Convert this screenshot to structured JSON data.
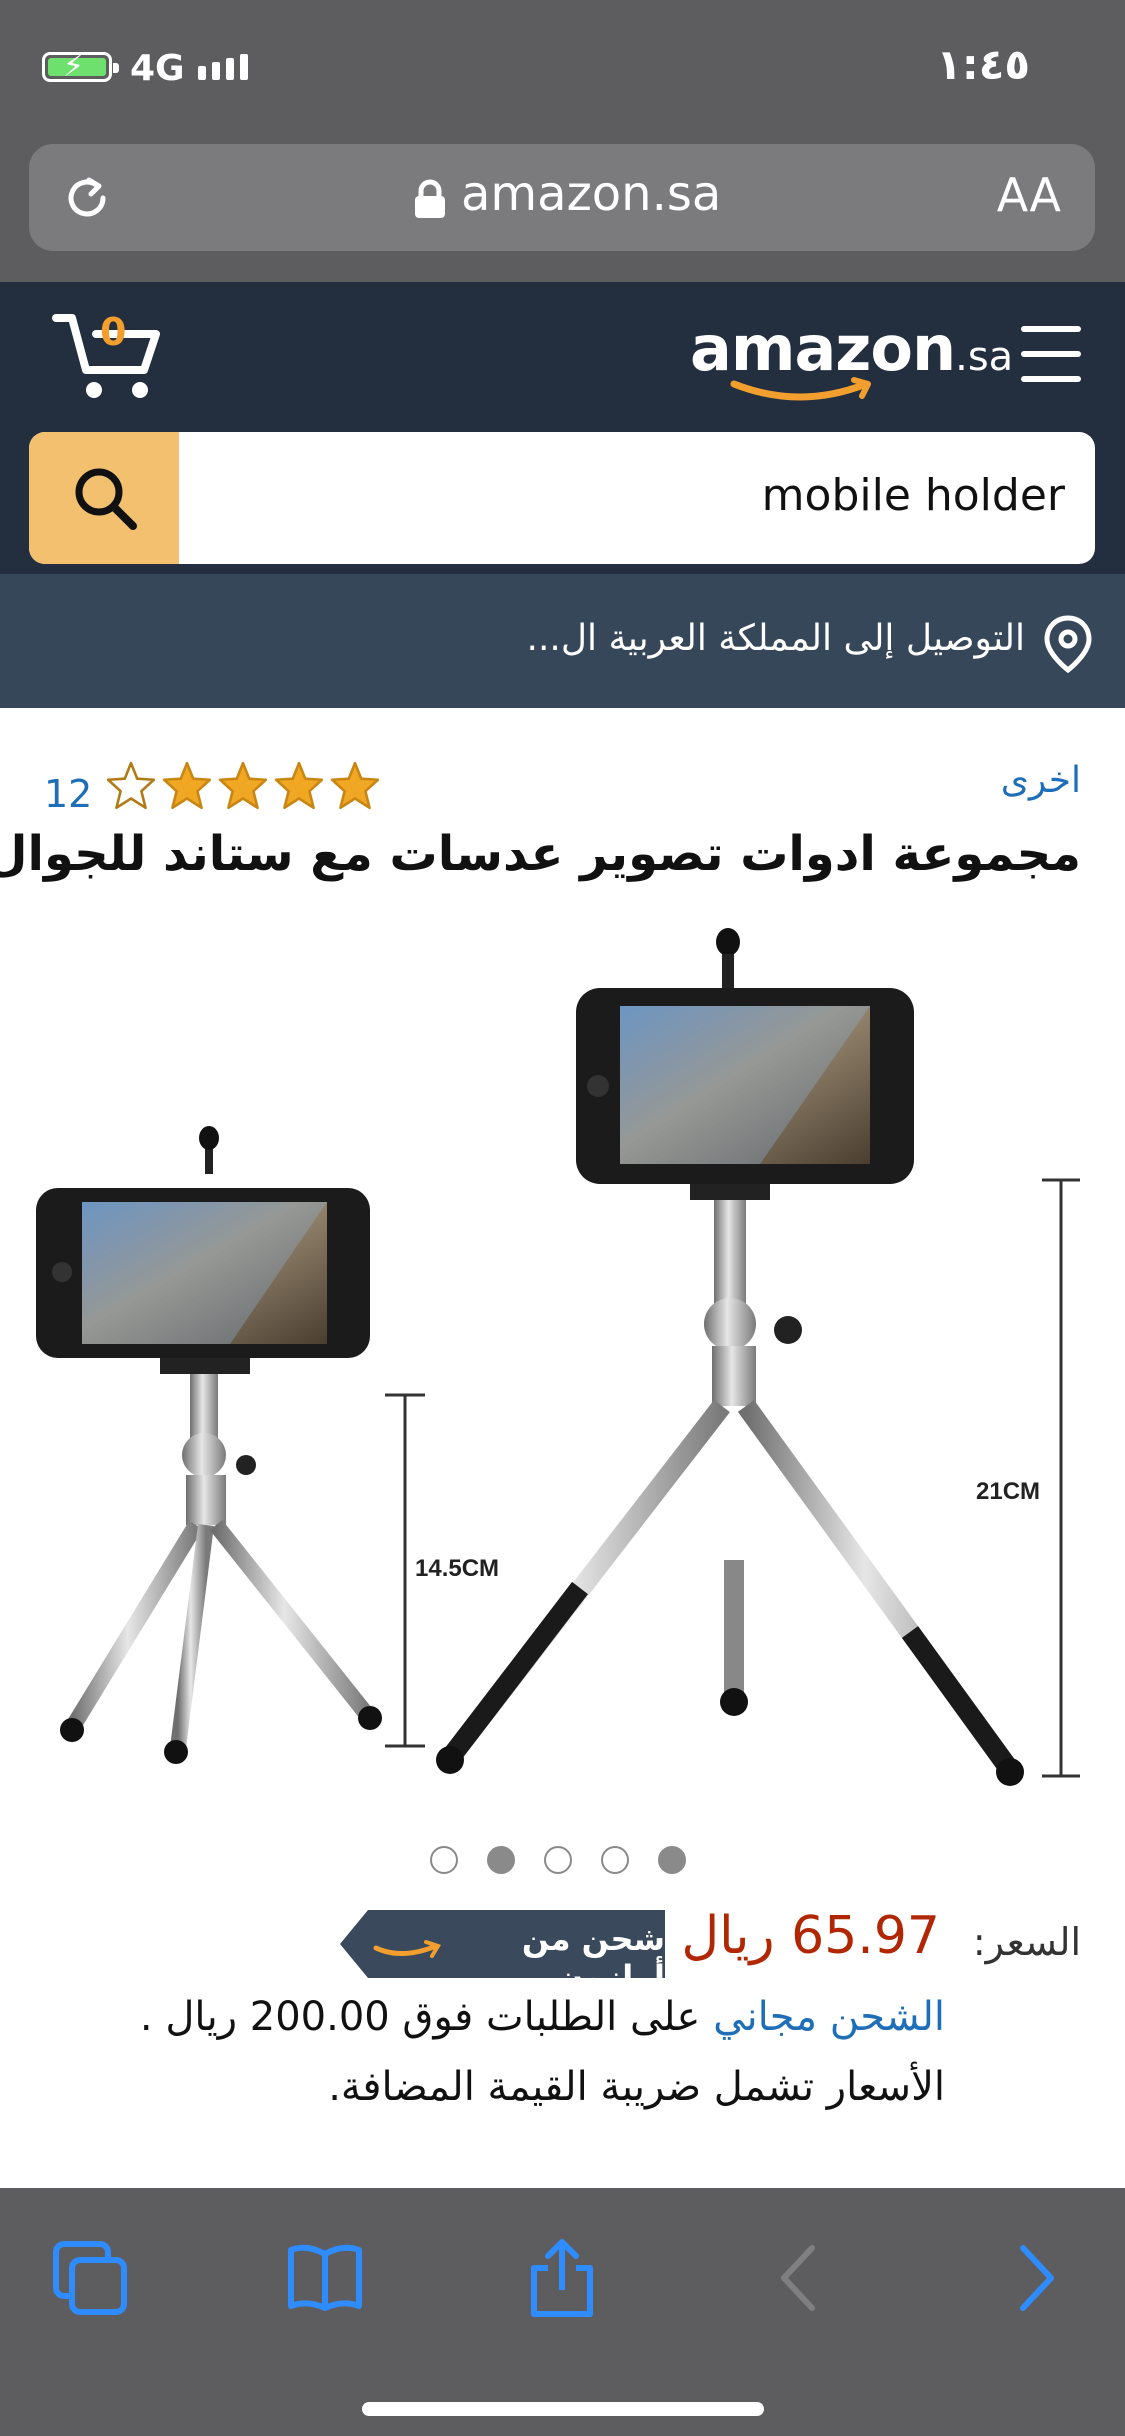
{
  "status_bar": {
    "time": "١:٤٥",
    "network": "4G"
  },
  "browser": {
    "domain": "amazon.sa",
    "text_size_label": "AA"
  },
  "header": {
    "logo_main": "amazon",
    "logo_tld": ".sa",
    "cart_count": "0",
    "search_value": "mobile holder"
  },
  "delivery": {
    "text": "التوصيل إلى المملكة العربية ال..."
  },
  "product": {
    "brand_link": "اخرى",
    "rating_stars": 5,
    "rating_filled": 4,
    "rating_count": "12",
    "title": "مجموعة ادوات تصوير عدسات مع ستاند للجوال",
    "image_labels": {
      "left_height": "14.5CM",
      "right_height": "21CM"
    },
    "image_count": 5,
    "active_image": 4,
    "price_label": "السعر:",
    "price": "65.97 ريال",
    "badge_text": "شحن من أمازون",
    "shipping_link": "الشحن مجاني",
    "shipping_text": " على الطلبات فوق 200.00 ريال .",
    "vat_text": "الأسعار تشمل ضريبة القيمة المضافة."
  },
  "colors": {
    "chrome": "#5d5d5f",
    "amazon_dark": "#232f3e",
    "delivery_bar": "#37475a",
    "search_button": "#f3c06f",
    "price": "#b12704",
    "link": "#1f6fb8",
    "star": "#f0a824"
  }
}
